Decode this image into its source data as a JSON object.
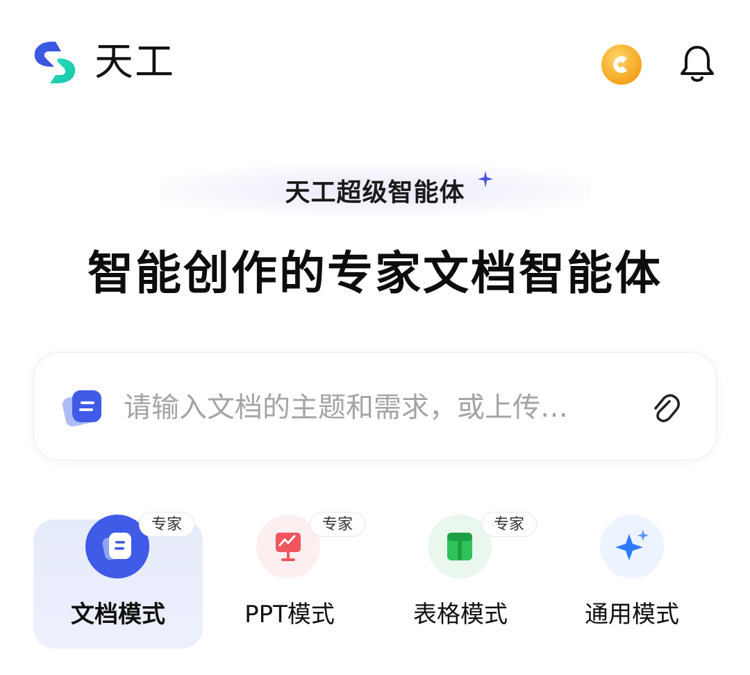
{
  "header": {
    "app_name": "天工",
    "logo_icon": "tiangong-logo-icon",
    "coin_icon": "coin-icon",
    "notification_icon": "bell-icon"
  },
  "hero": {
    "badge": "天工超级智能体",
    "headline": "智能创作的专家文档智能体"
  },
  "search": {
    "placeholder": "请输入文档的主题和需求，或上传…",
    "leading_icon": "document-icon",
    "trailing_icon": "attachment-icon"
  },
  "modes": [
    {
      "label": "文档模式",
      "tag": "专家",
      "icon": "document-icon",
      "selected": true
    },
    {
      "label": "PPT模式",
      "tag": "专家",
      "icon": "presentation-icon",
      "selected": false
    },
    {
      "label": "表格模式",
      "tag": "专家",
      "icon": "table-icon",
      "selected": false
    },
    {
      "label": "通用模式",
      "icon": "sparkle-icon",
      "selected": false
    }
  ],
  "colors": {
    "brand_blue": "#3f5be8",
    "brand_teal": "#1fd2b4",
    "coin_orange": "#f4a21a",
    "ppt_red": "#f0565e",
    "table_green": "#2fc25b",
    "sparkle_blue": "#2f7bff"
  }
}
